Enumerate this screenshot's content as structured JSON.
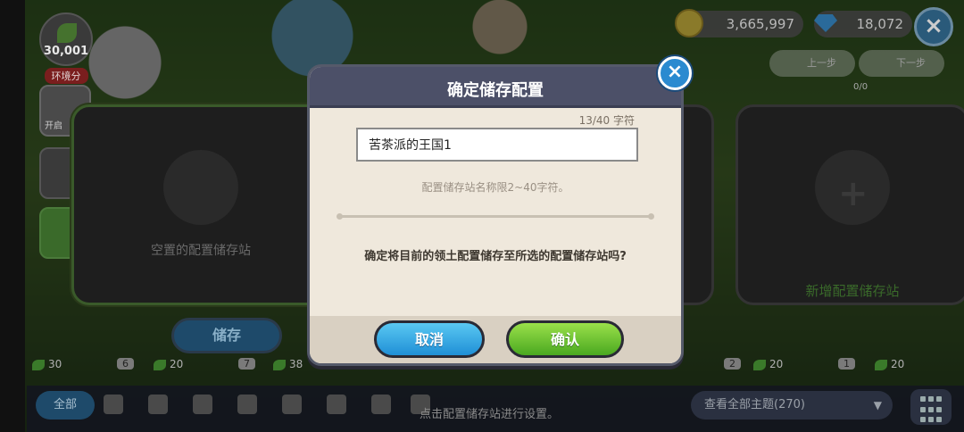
{
  "env": {
    "score": "30,001",
    "label": "环境分"
  },
  "side": {
    "open_label": "开启"
  },
  "currency": {
    "gold": "3,665,997",
    "gems": "18,072"
  },
  "history": {
    "undo_label": "上一步",
    "redo_label": "下一步",
    "count": "0/0"
  },
  "slots": {
    "empty_label": "空置的配置储存站",
    "add_label": "新增配置储存站",
    "save_label": "储存"
  },
  "inventory": [
    {
      "level": "30",
      "qty": "6"
    },
    {
      "level": "20",
      "qty": "7"
    },
    {
      "level": "38",
      "qty": ""
    },
    {
      "level": "",
      "qty": "2"
    },
    {
      "level": "20",
      "qty": "1"
    },
    {
      "level": "20",
      "qty": ""
    }
  ],
  "bottom": {
    "tab_all": "全部",
    "hint": "点击配置储存站进行设置。",
    "theme_select": "查看全部主题(270)"
  },
  "modal": {
    "title": "确定储存配置",
    "char_count": "13/40 字符",
    "name_value": "苦茶派的王国1",
    "hint": "配置储存站名称限2~40字符。",
    "question": "确定将目前的领土配置储存至所选的配置储存站吗?",
    "cancel_label": "取消",
    "ok_label": "确认"
  },
  "colors": {
    "cancel": "#1f8fd6",
    "ok": "#4aa820",
    "header": "#4c5068",
    "body": "#efe8dc"
  }
}
